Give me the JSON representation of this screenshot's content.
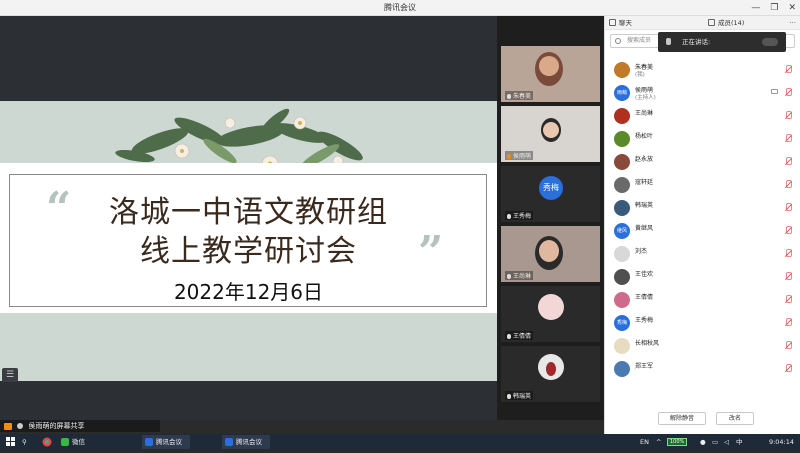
{
  "window": {
    "title": "腾讯会议"
  },
  "slide": {
    "title_line1": "洛城一中语文教研组",
    "title_line2": "线上教学研讨会",
    "date": "2022年12月6日",
    "quote_open": "“",
    "quote_close": "”"
  },
  "video_tiles": [
    {
      "name": "朱春美"
    },
    {
      "name": "侯雨萌"
    },
    {
      "name": "王秀梅",
      "avatar_text": "秀梅"
    },
    {
      "name": "王尚琳"
    },
    {
      "name": "王倩倩"
    },
    {
      "name": "韩瑞英"
    }
  ],
  "panel": {
    "tab_chat": "聊天",
    "tab_members": "成员(14)",
    "more": "···",
    "search_placeholder": "搜索成员",
    "speaking_label": "正在讲话:",
    "members": [
      {
        "name": "朱春美",
        "sub": "(我)",
        "color": "#c07a2a"
      },
      {
        "name": "侯雨萌",
        "sub": "(主持人)",
        "avatar_text": "雨萌",
        "color": "#2a6fdb"
      },
      {
        "name": "王尚琳",
        "color": "#b03020"
      },
      {
        "name": "杨松叶",
        "color": "#5a8a2a"
      },
      {
        "name": "赵永放",
        "color": "#8a4a3a"
      },
      {
        "name": "寇轩廷",
        "color": "#6a6a6a"
      },
      {
        "name": "韩瑞英",
        "color": "#3a5a7a"
      },
      {
        "name": "黄继风",
        "avatar_text": "继风",
        "color": "#2a6fdb"
      },
      {
        "name": "刘杰",
        "color": "#d8d8d8"
      },
      {
        "name": "王佳欢",
        "color": "#505050"
      },
      {
        "name": "王倩倩",
        "color": "#d06a8a"
      },
      {
        "name": "王秀梅",
        "avatar_text": "秀梅",
        "color": "#2a6fdb"
      },
      {
        "name": "长相秋风",
        "color": "#e8dcc0"
      },
      {
        "name": "郑王军",
        "color": "#4a7ab0"
      }
    ],
    "btn_unmute": "解除静音",
    "btn_rename": "改名"
  },
  "share_bar": {
    "label": "侯雨萌的屏幕共享"
  },
  "taskbar": {
    "app1": "微信",
    "app2": "腾讯会议",
    "app3": "腾讯会议",
    "battery": "100%",
    "ime": "EN",
    "time": "9:04:14"
  }
}
